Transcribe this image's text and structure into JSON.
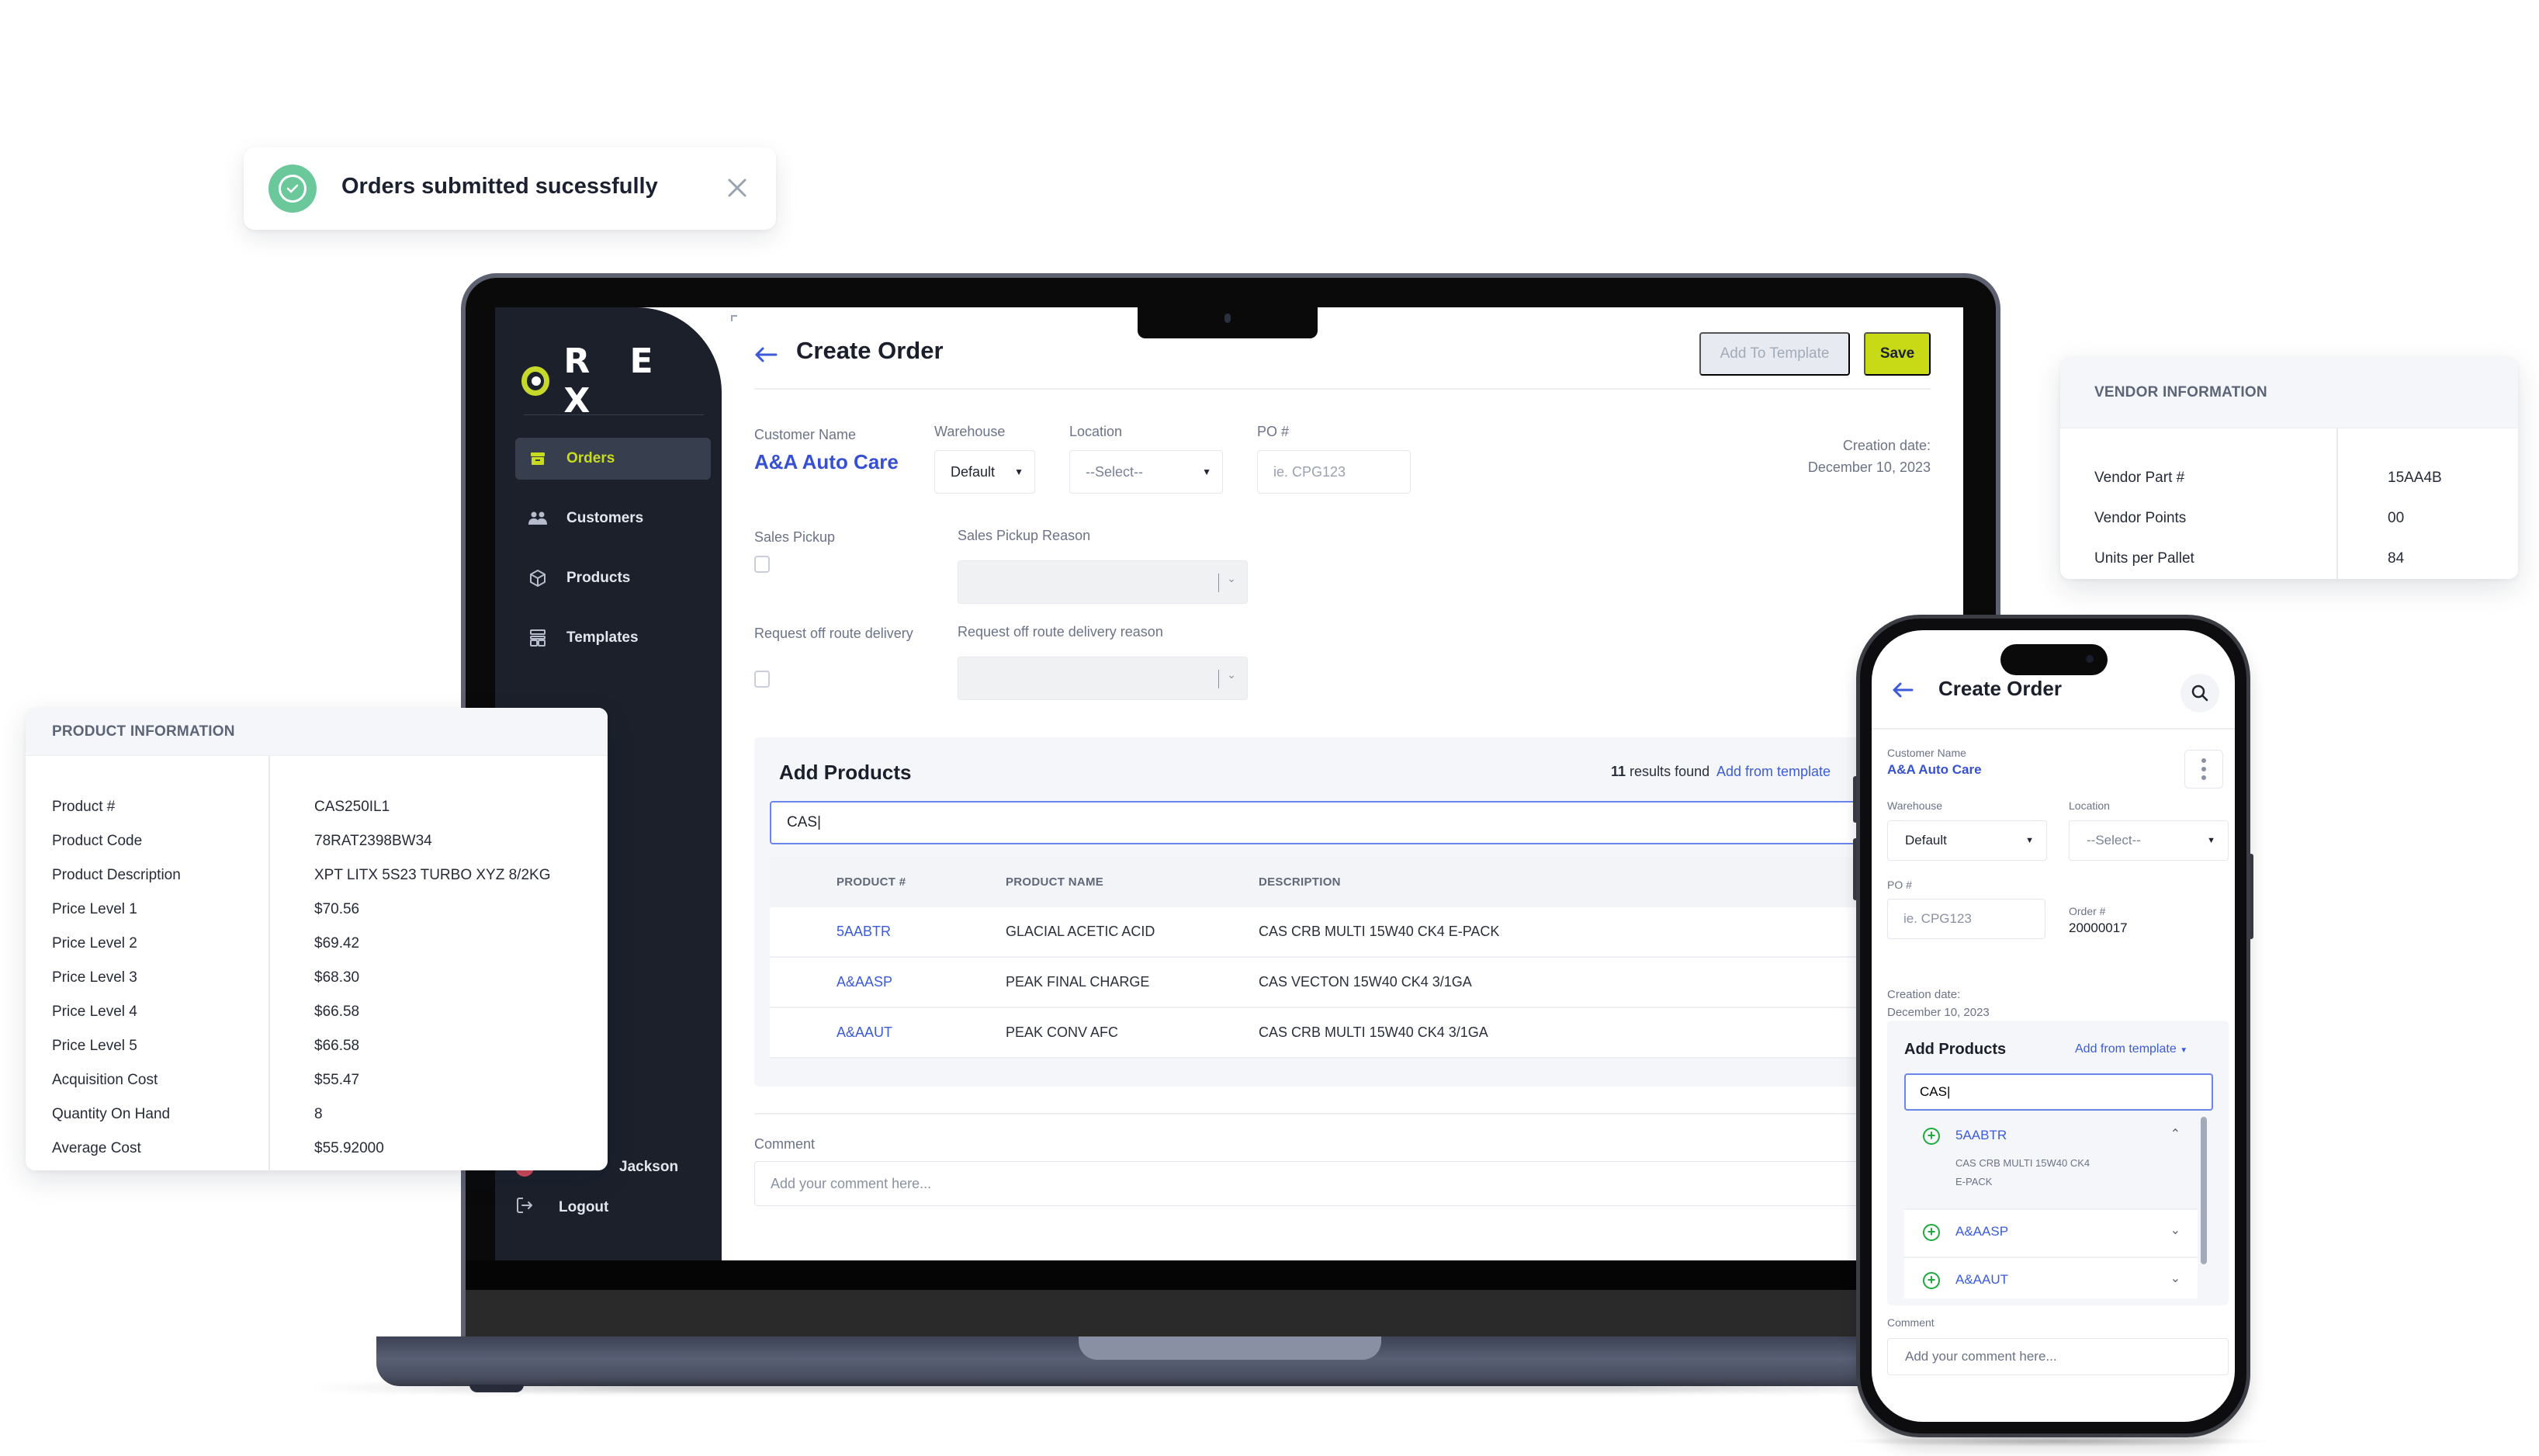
{
  "toast": {
    "message": "Orders submitted sucessfully",
    "icon": "check-circle-icon",
    "close_icon": "close-icon",
    "color": "#6ac89a"
  },
  "app": {
    "brand": "R.EX",
    "brand_display": "R E X",
    "accent_color": "#c8d916",
    "link_color": "#3b5bdb",
    "sidebar": {
      "items": [
        {
          "label": "Orders",
          "icon": "archive-box-icon",
          "active": true
        },
        {
          "label": "Customers",
          "icon": "users-icon",
          "active": false
        },
        {
          "label": "Products",
          "icon": "cube-icon",
          "active": false
        },
        {
          "label": "Templates",
          "icon": "layout-template-icon",
          "active": false
        }
      ],
      "user_name": "Jackson",
      "logout_label": "Logout"
    },
    "header": {
      "title": "Create Order",
      "add_to_template_label": "Add To Template",
      "save_label": "Save"
    },
    "form": {
      "customer_name_label": "Customer Name",
      "customer_name": "A&A Auto Care",
      "warehouse_label": "Warehouse",
      "warehouse_value": "Default",
      "location_label": "Location",
      "location_value": "--Select--",
      "po_label": "PO #",
      "po_placeholder": "ie. CPG123",
      "creation_date_label": "Creation date:",
      "creation_date": "December 10, 2023",
      "sales_pickup_label": "Sales Pickup",
      "sales_pickup_checked": false,
      "sales_pickup_reason_label": "Sales Pickup Reason",
      "off_route_label": "Request off route delivery",
      "off_route_checked": false,
      "off_route_reason_label": "Request off route delivery reason"
    },
    "add_products": {
      "title": "Add Products",
      "results_count": "11",
      "results_suffix": "results found",
      "add_from_template_label": "Add from template",
      "search_value": "CAS|",
      "columns": [
        "PRODUCT #",
        "PRODUCT NAME",
        "DESCRIPTION"
      ],
      "rows": [
        {
          "product_no": "5AABTR",
          "name": "GLACIAL ACETIC ACID",
          "description": "CAS CRB MULTI 15W40 CK4 E-PACK"
        },
        {
          "product_no": "A&AASP",
          "name": "PEAK FINAL CHARGE",
          "description": "CAS VECTON 15W40 CK4 3/1GA"
        },
        {
          "product_no": "A&AAUT",
          "name": "PEAK CONV AFC",
          "description": "CAS CRB MULTI 15W40 CK4 3/1GA"
        }
      ]
    },
    "comment": {
      "label": "Comment",
      "placeholder": "Add your comment here..."
    }
  },
  "product_information": {
    "title": "PRODUCT INFORMATION",
    "rows": [
      {
        "key": "Product #",
        "value": "CAS250IL1"
      },
      {
        "key": "Product Code",
        "value": "78RAT2398BW34"
      },
      {
        "key": "Product Description",
        "value": "XPT LITX 5S23 TURBO XYZ 8/2KG"
      },
      {
        "key": "Price Level 1",
        "value": "$70.56"
      },
      {
        "key": "Price Level 2",
        "value": "$69.42"
      },
      {
        "key": "Price Level 3",
        "value": "$68.30"
      },
      {
        "key": "Price Level 4",
        "value": "$66.58"
      },
      {
        "key": "Price Level 5",
        "value": "$66.58"
      },
      {
        "key": "Acquisition Cost",
        "value": "$55.47"
      },
      {
        "key": "Quantity On Hand",
        "value": "8"
      },
      {
        "key": "Average Cost",
        "value": "$55.92000"
      }
    ]
  },
  "vendor_information": {
    "title": "VENDOR INFORMATION",
    "rows": [
      {
        "key": "Vendor Part #",
        "value": "15AA4B"
      },
      {
        "key": "Vendor Points",
        "value": "00"
      },
      {
        "key": "Units per Pallet",
        "value": "84"
      }
    ]
  },
  "mobile": {
    "title": "Create Order",
    "customer_name_label": "Customer Name",
    "customer_name": "A&A Auto Care",
    "warehouse_label": "Warehouse",
    "warehouse_value": "Default",
    "location_label": "Location",
    "location_value": "--Select--",
    "po_label": "PO #",
    "po_placeholder": "ie. CPG123",
    "order_no_label": "Order #",
    "order_no": "20000017",
    "creation_date_label": "Creation date:",
    "creation_date": "December 10, 2023",
    "add_products_title": "Add Products",
    "add_from_template_label": "Add from template",
    "search_value": "CAS|",
    "items": [
      {
        "code": "5AABTR",
        "description_line1": "CAS CRB MULTI 15W40 CK4",
        "description_line2": "E-PACK",
        "expanded": true
      },
      {
        "code": "A&AASP",
        "expanded": false
      },
      {
        "code": "A&AAUT",
        "expanded": false
      }
    ],
    "comment_label": "Comment",
    "comment_placeholder": "Add your comment here..."
  }
}
